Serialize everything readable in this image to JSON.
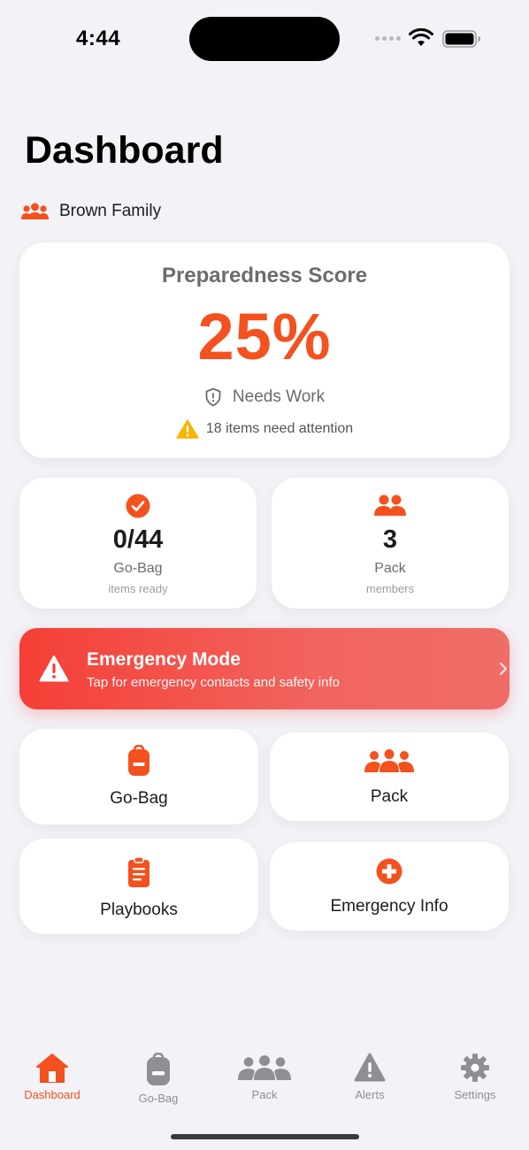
{
  "status_bar": {
    "time": "4:44"
  },
  "page": {
    "title": "Dashboard"
  },
  "family": {
    "name": "Brown Family",
    "icon": "people-icon"
  },
  "score": {
    "title": "Preparedness Score",
    "value": "25%",
    "status": "Needs Work",
    "attention": "18 items need attention"
  },
  "stats": [
    {
      "icon": "checkmark-circle-icon",
      "value": "0/44",
      "label": "Go-Bag",
      "sub": "items ready"
    },
    {
      "icon": "people-icon",
      "value": "3",
      "label": "Pack",
      "sub": "members"
    }
  ],
  "emergency": {
    "title": "Emergency Mode",
    "subtitle": "Tap for emergency contacts and safety info"
  },
  "actions": [
    {
      "label": "Go-Bag",
      "icon": "backpack-icon"
    },
    {
      "label": "Pack",
      "icon": "group-icon"
    },
    {
      "label": "Playbooks",
      "icon": "clipboard-icon"
    },
    {
      "label": "Emergency Info",
      "icon": "medical-cross-icon"
    }
  ],
  "tabs": [
    {
      "label": "Dashboard",
      "icon": "house-icon",
      "active": true
    },
    {
      "label": "Go-Bag",
      "icon": "backpack-icon",
      "active": false
    },
    {
      "label": "Pack",
      "icon": "group-icon",
      "active": false
    },
    {
      "label": "Alerts",
      "icon": "warning-icon",
      "active": false
    },
    {
      "label": "Settings",
      "icon": "gear-icon",
      "active": false
    }
  ],
  "colors": {
    "accent": "#f4511e",
    "emergency": "#f43f36",
    "background": "#f2f2f7",
    "warning": "#f7b500"
  }
}
